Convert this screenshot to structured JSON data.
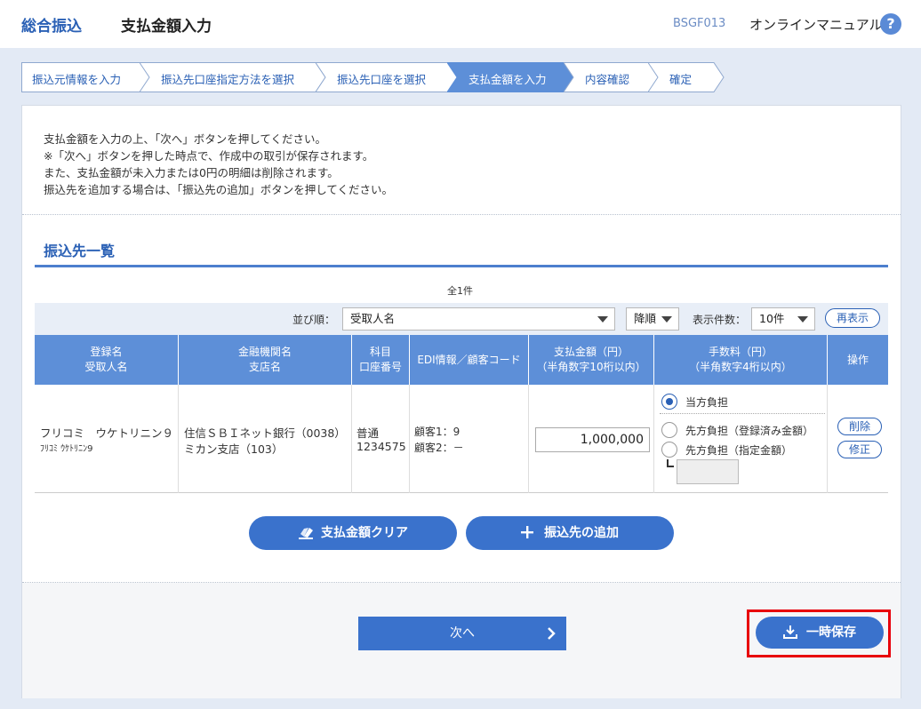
{
  "header": {
    "service": "総合振込",
    "title": "支払金額入力",
    "screen_id": "BSGF013",
    "manual": "オンラインマニュアル",
    "help_glyph": "?"
  },
  "steps": [
    {
      "label": "振込元情報を入力",
      "active": false
    },
    {
      "label": "振込先口座指定方法を選択",
      "active": false
    },
    {
      "label": "振込先口座を選択",
      "active": false
    },
    {
      "label": "支払金額を入力",
      "active": true
    },
    {
      "label": "内容確認",
      "active": false
    },
    {
      "label": "確定",
      "active": false
    }
  ],
  "intro": [
    "支払金額を入力の上、「次へ」ボタンを押してください。",
    "※「次へ」ボタンを押した時点で、作成中の取引が保存されます。",
    "また、支払金額が未入力または0円の明細は削除されます。",
    "振込先を追加する場合は、「振込先の追加」ボタンを押してください。"
  ],
  "section_title": "振込先一覧",
  "count": "全1件",
  "sort": {
    "label": "並び順：",
    "field": "受取人名",
    "order": "降順",
    "per_page_label": "表示件数：",
    "per_page": "10件",
    "redisplay": "再表示"
  },
  "columns": [
    [
      "登録名",
      "受取人名"
    ],
    [
      "金融機関名",
      "支店名"
    ],
    [
      "科目",
      "口座番号"
    ],
    [
      "EDI情報／顧客コード"
    ],
    [
      "支払金額（円）",
      "（半角数字10桁以内）"
    ],
    [
      "手数料（円）",
      "（半角数字4桁以内）"
    ],
    [
      "操作"
    ]
  ],
  "row": {
    "name": "フリコミ　ウケトリニン９",
    "name_kana": "ﾌﾘｺﾐ ｳｹﾄﾘﾆﾝ9",
    "bank": "住信ＳＢＩネット銀行（0038）",
    "branch": "ミカン支店（103）",
    "type": "普通",
    "account": "1234575",
    "edi1": "顧客1：9",
    "edi2": "顧客2：－",
    "amount": "1,000,000",
    "fee_options": [
      {
        "label": "当方負担",
        "selected": true
      },
      {
        "label": "先方負担（登録済み金額）",
        "selected": false
      },
      {
        "label": "先方負担（指定金額）",
        "selected": false
      }
    ],
    "fee_value": "",
    "delete": "削除",
    "edit": "修正"
  },
  "buttons": {
    "clear": "支払金額クリア",
    "add": "振込先の追加",
    "next": "次へ",
    "save": "一時保存"
  },
  "colors": {
    "primary": "#3a72cc",
    "header_blue": "#5d8fd8",
    "highlight": "#e8000b"
  },
  "icons": {
    "clear": "eraser-icon",
    "add": "plus-icon",
    "next": "chevron-right-icon",
    "save": "download-icon",
    "help": "question-circle-icon"
  }
}
